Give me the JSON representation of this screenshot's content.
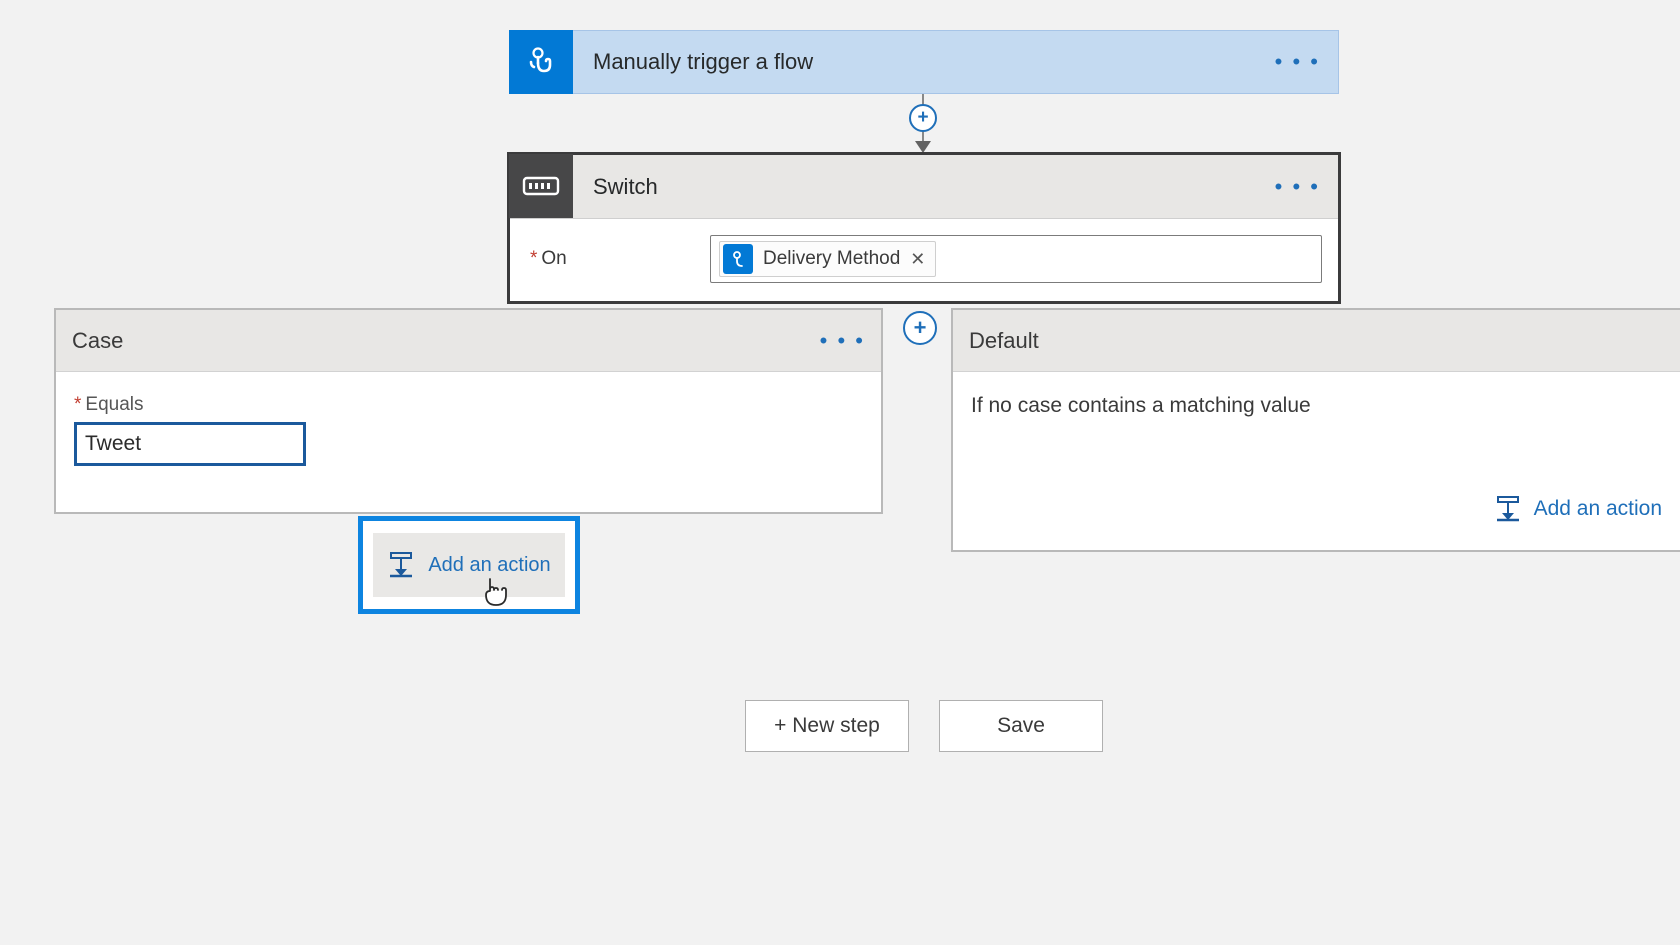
{
  "trigger": {
    "title": "Manually trigger a flow"
  },
  "switch": {
    "title": "Switch",
    "on_label": "On",
    "token_label": "Delivery Method"
  },
  "case": {
    "title": "Case",
    "equals_label": "Equals",
    "equals_value": "Tweet",
    "add_action_label": "Add an action"
  },
  "default": {
    "title": "Default",
    "description": "If no case contains a matching value",
    "add_action_label": "Add an action"
  },
  "footer": {
    "new_step_label": "+ New step",
    "save_label": "Save"
  }
}
